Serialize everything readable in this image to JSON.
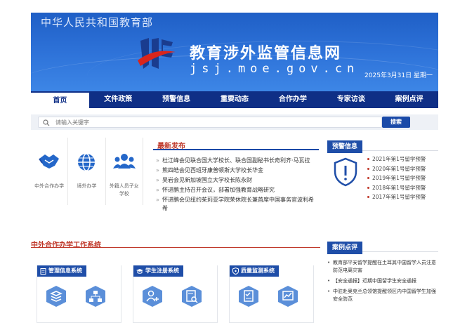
{
  "header": {
    "ministry": "中华人民共和国教育部",
    "title": "教育涉外监管信息网",
    "domain": "jsj.moe.gov.cn",
    "date": "2025年3月31日 星期一"
  },
  "nav": [
    {
      "label": "首页",
      "active": true
    },
    {
      "label": "文件政策"
    },
    {
      "label": "预警信息"
    },
    {
      "label": "重要动态"
    },
    {
      "label": "合作办学"
    },
    {
      "label": "专家访谈"
    },
    {
      "label": "案例点评"
    }
  ],
  "search": {
    "placeholder": "请输入关键字",
    "button": "搜索"
  },
  "quick_links": [
    {
      "label": "中外合作办学",
      "icon": "handshake-icon"
    },
    {
      "label": "境外办学",
      "icon": "globe-icon"
    },
    {
      "label": "外籍人员子女学校",
      "icon": "group-icon"
    }
  ],
  "news": {
    "title": "最新发布",
    "items": [
      "杜江峰会见联合国大学校长、联合国副秘书长奇利齐·马瓦拉",
      "熊四皓会见西班牙康普顿斯大学校长华金",
      "吴岩会见新加坡国立大学校长陈永财",
      "怀进鹏主持召开会议，部署加强教育战略研究",
      "怀进鹏会见纽约茱莉亚学院荣休院长兼首席中国事务官波利希希"
    ]
  },
  "warnings": {
    "title": "预警信息",
    "items": [
      "2021年第1号留学预警",
      "2020年第1号留学预警",
      "2019年第1号留学预警",
      "2018年第1号留学预警",
      "2017年第1号留学预警"
    ]
  },
  "coop": {
    "title": "中外合作办学工作系统",
    "systems": [
      {
        "title": "管理信息系统"
      },
      {
        "title": "学生注册系统"
      },
      {
        "title": "质量监测系统"
      }
    ]
  },
  "cases": {
    "title": "案例点评",
    "items": [
      "教育部平安留学提醒在土耳其中国留学人员注意防范电离灾害",
      "【安全通报】近期中国留学生安全通报",
      "中驻赴奥克兰总领馆提醒领区内中国留学生加强安全防范"
    ]
  },
  "colors": {
    "brand": "#1f4ea8",
    "nav": "#0f2f86",
    "accent": "#c0392b"
  }
}
